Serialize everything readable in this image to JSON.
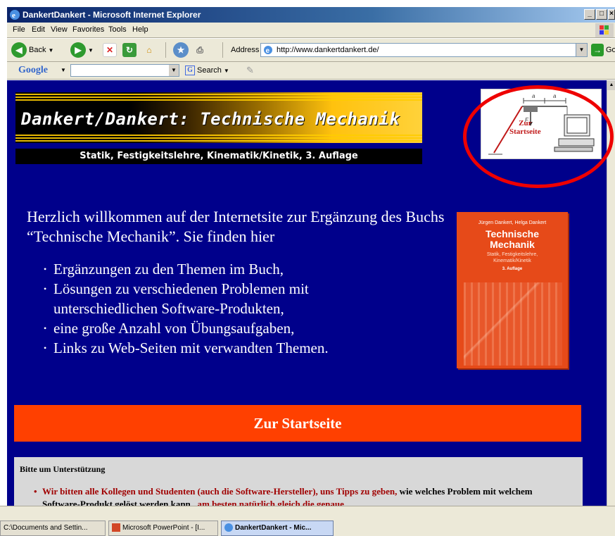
{
  "window": {
    "title": "DankertDankert - Microsoft Internet Explorer",
    "controls": [
      "_",
      "□",
      "×"
    ]
  },
  "menu": [
    "File",
    "Edit",
    "View",
    "Favorites",
    "Tools",
    "Help"
  ],
  "toolbar": {
    "back_label": "Back",
    "address_label": "Address",
    "address_value": "http://www.dankertdankert.de/",
    "go_label": "Go"
  },
  "googlebar": {
    "logo": "Google",
    "search_label": "Search"
  },
  "page": {
    "banner_title": "Dankert/Dankert: Technische Mechanik",
    "banner_subtitle": "Statik, Festigkeitslehre, Kinematik/Kinetik, 3. Auflage",
    "logo_link_text_1": "Zur",
    "logo_link_text_2": "Startseite",
    "welcome": "Herzlich willkommen auf der Internetsite zur Ergänzung des Buchs “Technische Mechanik”. Sie finden hier",
    "bullets": [
      "Ergänzungen zu den Themen im Buch,",
      "Lösungen zu verschiedenen Problemen mit",
      "unterschiedlichen Software-Produkten,",
      "eine große Anzahl von Übungsaufgaben,",
      "Links zu Web-Seiten mit verwandten Themen."
    ],
    "book": {
      "authors": "Jürgen Dankert, Helga Dankert",
      "title_1": "Technische",
      "title_2": "Mechanik",
      "subtitle_1": "Statik, Festigkeitslehre,",
      "subtitle_2": "Kinematik/Kinetik",
      "edition": "3. Auflage"
    },
    "start_button": "Zur Startseite",
    "support_heading": "Bitte um Unterstützung",
    "support_text_red_1": "Wir bitten alle Kollegen und Studenten (auch die Software-Hersteller), uns Tipps zu geben,",
    "support_text_black_1": "wie welches Problem mit welchem Software-Produkt gelöst werden kann",
    "support_text_red_2": ", am besten natürlich gleich die genaue"
  },
  "taskbar": [
    "C:\\Documents and Settin...",
    "Microsoft PowerPoint - [I...",
    "DankertDankert - Mic..."
  ],
  "colors": {
    "page_background": "#00008b",
    "start_bar": "#ff4000",
    "highlight_ring": "#e00000"
  }
}
